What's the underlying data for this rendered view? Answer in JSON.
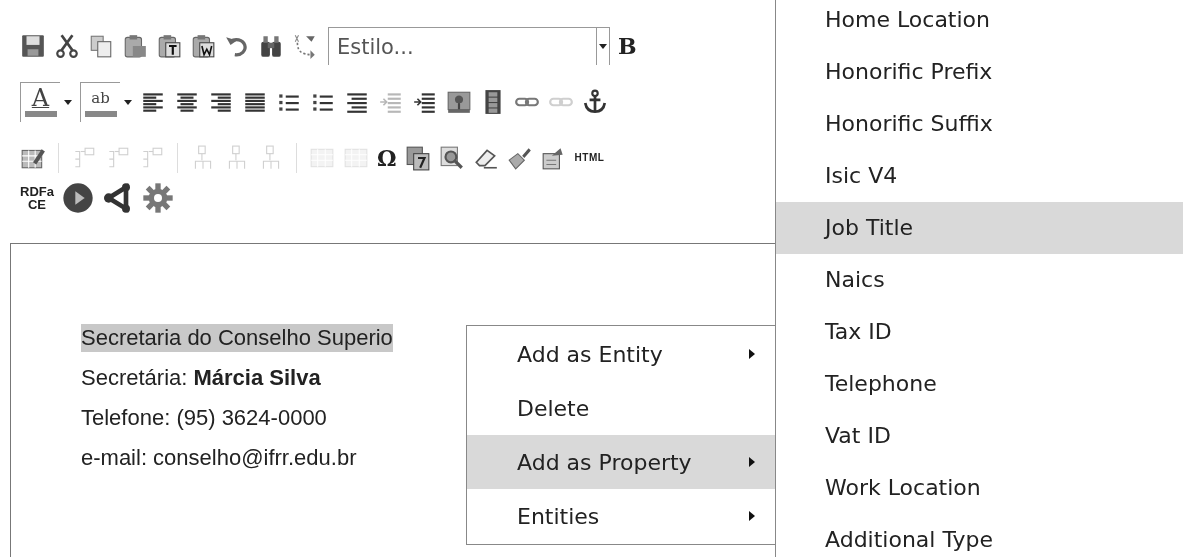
{
  "toolbar": {
    "rows": [
      [
        {
          "kind": "save",
          "disabled": false
        },
        {
          "kind": "cut",
          "disabled": false
        },
        {
          "kind": "copy",
          "disabled": false
        },
        {
          "kind": "paste",
          "disabled": false
        },
        {
          "kind": "paste-text",
          "disabled": false
        },
        {
          "kind": "paste-word",
          "disabled": false
        },
        {
          "kind": "undo",
          "disabled": false
        },
        {
          "kind": "find",
          "disabled": false
        },
        {
          "kind": "replace",
          "disabled": false
        },
        {
          "kind": "dropdown",
          "label": "Estilo..."
        },
        {
          "kind": "text",
          "label": "B",
          "disabled": false
        }
      ],
      [
        {
          "kind": "color",
          "label": "A"
        },
        {
          "kind": "color",
          "label": "ab"
        },
        {
          "kind": "align-left",
          "disabled": false
        },
        {
          "kind": "align-center",
          "disabled": false
        },
        {
          "kind": "align-right",
          "disabled": false
        },
        {
          "kind": "justify",
          "disabled": false
        },
        {
          "kind": "bullets",
          "disabled": false
        },
        {
          "kind": "numbers",
          "disabled": false
        },
        {
          "kind": "indent-list",
          "disabled": false
        },
        {
          "kind": "outdent",
          "disabled": true
        },
        {
          "kind": "indent",
          "disabled": false
        },
        {
          "kind": "image",
          "disabled": false
        },
        {
          "kind": "film",
          "disabled": false
        },
        {
          "kind": "link",
          "disabled": false
        },
        {
          "kind": "unlink",
          "disabled": true
        },
        {
          "kind": "anchor",
          "disabled": false
        }
      ],
      [
        {
          "kind": "table-edit",
          "disabled": false
        },
        {
          "kind": "separator"
        },
        {
          "kind": "column",
          "disabled": true
        },
        {
          "kind": "column",
          "disabled": true
        },
        {
          "kind": "column",
          "disabled": true
        },
        {
          "kind": "separator"
        },
        {
          "kind": "row",
          "disabled": true
        },
        {
          "kind": "row",
          "disabled": true
        },
        {
          "kind": "row",
          "disabled": true
        },
        {
          "kind": "separator"
        },
        {
          "kind": "table",
          "disabled": true
        },
        {
          "kind": "table",
          "disabled": true
        },
        {
          "kind": "text",
          "label": "Ω",
          "disabled": false
        },
        {
          "kind": "template",
          "disabled": false
        },
        {
          "kind": "preview",
          "disabled": false
        },
        {
          "kind": "eraser",
          "disabled": false
        },
        {
          "kind": "brush",
          "disabled": false
        },
        {
          "kind": "export",
          "disabled": false
        },
        {
          "kind": "small-text",
          "label": "HTML",
          "disabled": false
        }
      ],
      [
        {
          "kind": "stacked-text",
          "lines": [
            "RDFa",
            "CE"
          ],
          "disabled": false
        },
        {
          "kind": "play",
          "disabled": false
        },
        {
          "kind": "share",
          "disabled": false
        },
        {
          "kind": "gear",
          "disabled": false
        }
      ]
    ]
  },
  "content": {
    "lines": [
      {
        "text": "Secretaria do Conselho Superio",
        "selected": true
      },
      {
        "text": "Secretária: **Márcia Silva**",
        "selected": false
      },
      {
        "text": "Telefone: (95) 3624-0000",
        "selected": false
      },
      {
        "text": "e-mail: conselho@ifrr.edu.br",
        "selected": false
      }
    ]
  },
  "context_menu": {
    "items": [
      {
        "label": "Add as Entity",
        "selected": false,
        "has_submenu": true
      },
      {
        "label": "Delete",
        "selected": false,
        "has_submenu": false
      },
      {
        "label": "Add as Property",
        "selected": true,
        "has_submenu": true
      },
      {
        "label": "Entities",
        "selected": false,
        "has_submenu": true
      }
    ]
  },
  "submenu": {
    "items": [
      {
        "label": "Home Location",
        "selected": false
      },
      {
        "label": "Honorific Prefix",
        "selected": false
      },
      {
        "label": "Honorific Suffix",
        "selected": false
      },
      {
        "label": "Isic V4",
        "selected": false
      },
      {
        "label": "Job Title",
        "selected": true
      },
      {
        "label": "Naics",
        "selected": false
      },
      {
        "label": "Tax ID",
        "selected": false
      },
      {
        "label": "Telephone",
        "selected": false
      },
      {
        "label": "Vat ID",
        "selected": false
      },
      {
        "label": "Work Location",
        "selected": false
      },
      {
        "label": "Additional Type",
        "selected": false
      }
    ]
  }
}
